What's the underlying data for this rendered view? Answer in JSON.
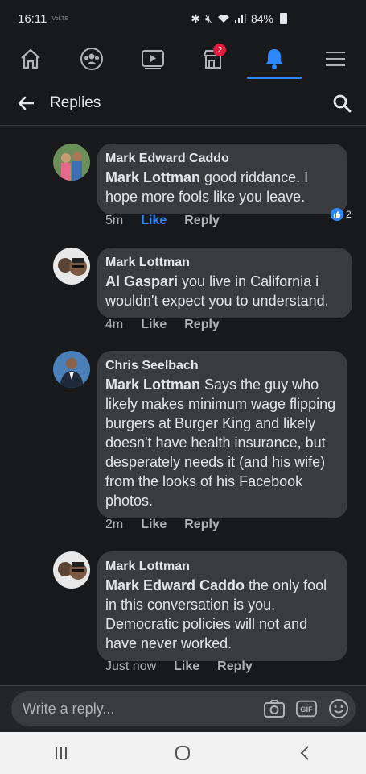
{
  "status": {
    "time": "16:11",
    "carrier": "VoLTE",
    "battery": "84%"
  },
  "nav": {
    "notifications_badge": "2",
    "items": [
      "home-icon",
      "groups-icon",
      "watch-icon",
      "marketplace-icon",
      "bell-icon",
      "menu-icon"
    ]
  },
  "header": {
    "title": "Replies"
  },
  "comments": [
    {
      "author": "Mark Edward Caddo",
      "mention": "Mark Lottman",
      "text": " good riddance.  I hope more fools like you leave.",
      "time": "5m",
      "like": "Like",
      "reply": "Reply",
      "liked": true,
      "reaction_count": "2"
    },
    {
      "author": "Mark Lottman",
      "mention": "Al Gaspari",
      "text": " you live in California i wouldn't expect you to understand.",
      "time": "4m",
      "like": "Like",
      "reply": "Reply"
    },
    {
      "author": "Chris Seelbach",
      "mention": "Mark Lottman",
      "text": " Says the guy who likely makes minimum wage flipping burgers at Burger King and likely doesn't have health insurance, but desperately needs it (and his wife) from the looks of his Facebook photos.",
      "time": "2m",
      "like": "Like",
      "reply": "Reply"
    },
    {
      "author": "Mark Lottman",
      "mention": "Mark Edward Caddo",
      "text": " the only fool in this conversation is you. Democratic policies will not and have never worked.",
      "time": "Just now",
      "like": "Like",
      "reply": "Reply"
    }
  ],
  "composer": {
    "placeholder": "Write a reply...",
    "gif": "GIF"
  },
  "colors": {
    "bg": "#18191a",
    "bubble": "#3a3b3c",
    "accent": "#2d88ff"
  }
}
